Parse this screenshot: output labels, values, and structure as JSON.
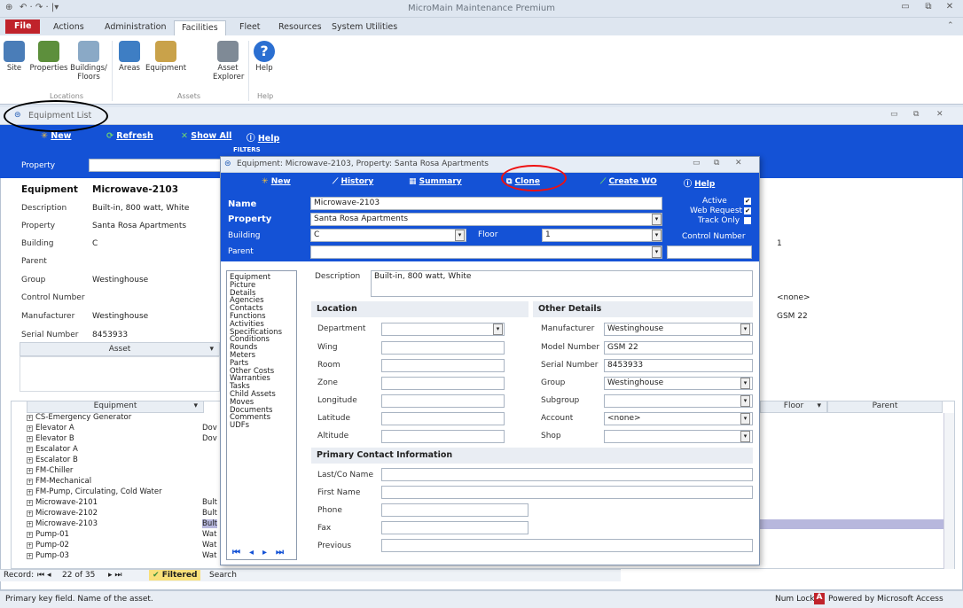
{
  "app": {
    "title": "MicroMain Maintenance Premium"
  },
  "ribbon": {
    "tabs": [
      "File",
      "Actions",
      "Administration",
      "Facilities",
      "Fleet",
      "Resources",
      "System Utilities"
    ],
    "buttons": [
      {
        "label": "Site"
      },
      {
        "label": "Properties"
      },
      {
        "label": "Buildings/ Floors"
      },
      {
        "label": "Areas"
      },
      {
        "label": "Equipment"
      },
      {
        "label": "Asset Explorer"
      },
      {
        "label": "Help"
      }
    ],
    "groups": [
      "Locations",
      "Assets",
      "Help"
    ]
  },
  "eqlist": {
    "title": "Equipment List",
    "toolbar": {
      "new": "New",
      "refresh": "Refresh",
      "show_all": "Show All",
      "help": "Help",
      "filters": "FILTERS"
    },
    "property_label": "Property",
    "detail": {
      "header_label": "Equipment",
      "header_value": "Microwave-2103",
      "fields": [
        {
          "label": "Description",
          "value": "Built-in, 800 watt, White"
        },
        {
          "label": "Property",
          "value": "Santa Rosa Apartments"
        },
        {
          "label": "Building",
          "value": "C"
        },
        {
          "label": "Parent",
          "value": ""
        },
        {
          "label": "Group",
          "value": "Westinghouse"
        },
        {
          "label": "Control Number",
          "value": ""
        },
        {
          "label": "Manufacturer",
          "value": "Westinghouse"
        },
        {
          "label": "Serial Number",
          "value": "8453933"
        }
      ],
      "right_values": {
        "floor": "1",
        "account": "<none>",
        "model": "GSM 22"
      }
    },
    "asset_header": "Asset",
    "grid_headers": {
      "equipment": "Equipment",
      "floor": "Floor",
      "parent": "Parent"
    },
    "rows": [
      {
        "name": "CS-Emergency Generator",
        "desc": ""
      },
      {
        "name": "Elevator A",
        "desc": "Dov"
      },
      {
        "name": "Elevator B",
        "desc": "Dov"
      },
      {
        "name": "Escalator A",
        "desc": ""
      },
      {
        "name": "Escalator B",
        "desc": ""
      },
      {
        "name": "FM-Chiller",
        "desc": ""
      },
      {
        "name": "FM-Mechanical",
        "desc": ""
      },
      {
        "name": "FM-Pump, Circulating, Cold Water",
        "desc": ""
      },
      {
        "name": "Microwave-2101",
        "desc": "Bult"
      },
      {
        "name": "Microwave-2102",
        "desc": "Bult"
      },
      {
        "name": "Microwave-2103",
        "desc": "Bult"
      },
      {
        "name": "Pump-01",
        "desc": "Wat"
      },
      {
        "name": "Pump-02",
        "desc": "Wat"
      },
      {
        "name": "Pump-03",
        "desc": "Wat"
      }
    ],
    "record_nav": {
      "label": "Record:",
      "position": "22 of 35",
      "filtered": "Filtered",
      "search": "Search"
    }
  },
  "dialog": {
    "title": "Equipment: Microwave-2103, Property: Santa Rosa Apartments",
    "toolbar": {
      "new": "New",
      "history": "History",
      "summary": "Summary",
      "clone": "Clone",
      "create_wo": "Create WO",
      "help": "Help"
    },
    "name_label": "Name",
    "name_value": "Microwave-2103",
    "property_label": "Property",
    "property_value": "Santa Rosa Apartments",
    "building_label": "Building",
    "building_value": "C",
    "floor_label": "Floor",
    "floor_value": "1",
    "parent_label": "Parent",
    "parent_value": "",
    "active_label": "Active",
    "web_request_label": "Web Request",
    "track_only_label": "Track Only",
    "control_number_label": "Control Number",
    "nav_items": [
      "Equipment",
      "Picture",
      "Details",
      "Agencies",
      "Contacts",
      "Functions",
      "Activities",
      "Specifications",
      "Conditions",
      "Rounds",
      "Meters",
      "Parts",
      "Other Costs",
      "Warranties",
      "Tasks",
      "Child Assets",
      "Moves",
      "Documents",
      "Comments",
      "UDFs"
    ],
    "description_label": "Description",
    "description_value": "Built-in, 800 watt, White",
    "location": {
      "title": "Location",
      "fields": [
        "Department",
        "Wing",
        "Room",
        "Zone",
        "Longitude",
        "Latitude",
        "Altitude"
      ]
    },
    "other": {
      "title": "Other Details",
      "fields": [
        {
          "label": "Manufacturer",
          "value": "Westinghouse"
        },
        {
          "label": "Model Number",
          "value": "GSM 22"
        },
        {
          "label": "Serial Number",
          "value": "8453933"
        },
        {
          "label": "Group",
          "value": "Westinghouse"
        },
        {
          "label": "Subgroup",
          "value": ""
        },
        {
          "label": "Account",
          "value": "<none>"
        },
        {
          "label": "Shop",
          "value": ""
        }
      ]
    },
    "contact": {
      "title": "Primary Contact Information",
      "fields": [
        "Last/Co Name",
        "First Name",
        "Phone",
        "Fax",
        "Previous"
      ]
    }
  },
  "status": {
    "left": "Primary key field. Name of the asset.",
    "num_lock": "Num Lock",
    "powered": "Powered by Microsoft Access"
  },
  "colors": {
    "toolbar_blue": "#1452d6",
    "file_tab": "#c0232b",
    "annotation_red": "#e11111"
  }
}
